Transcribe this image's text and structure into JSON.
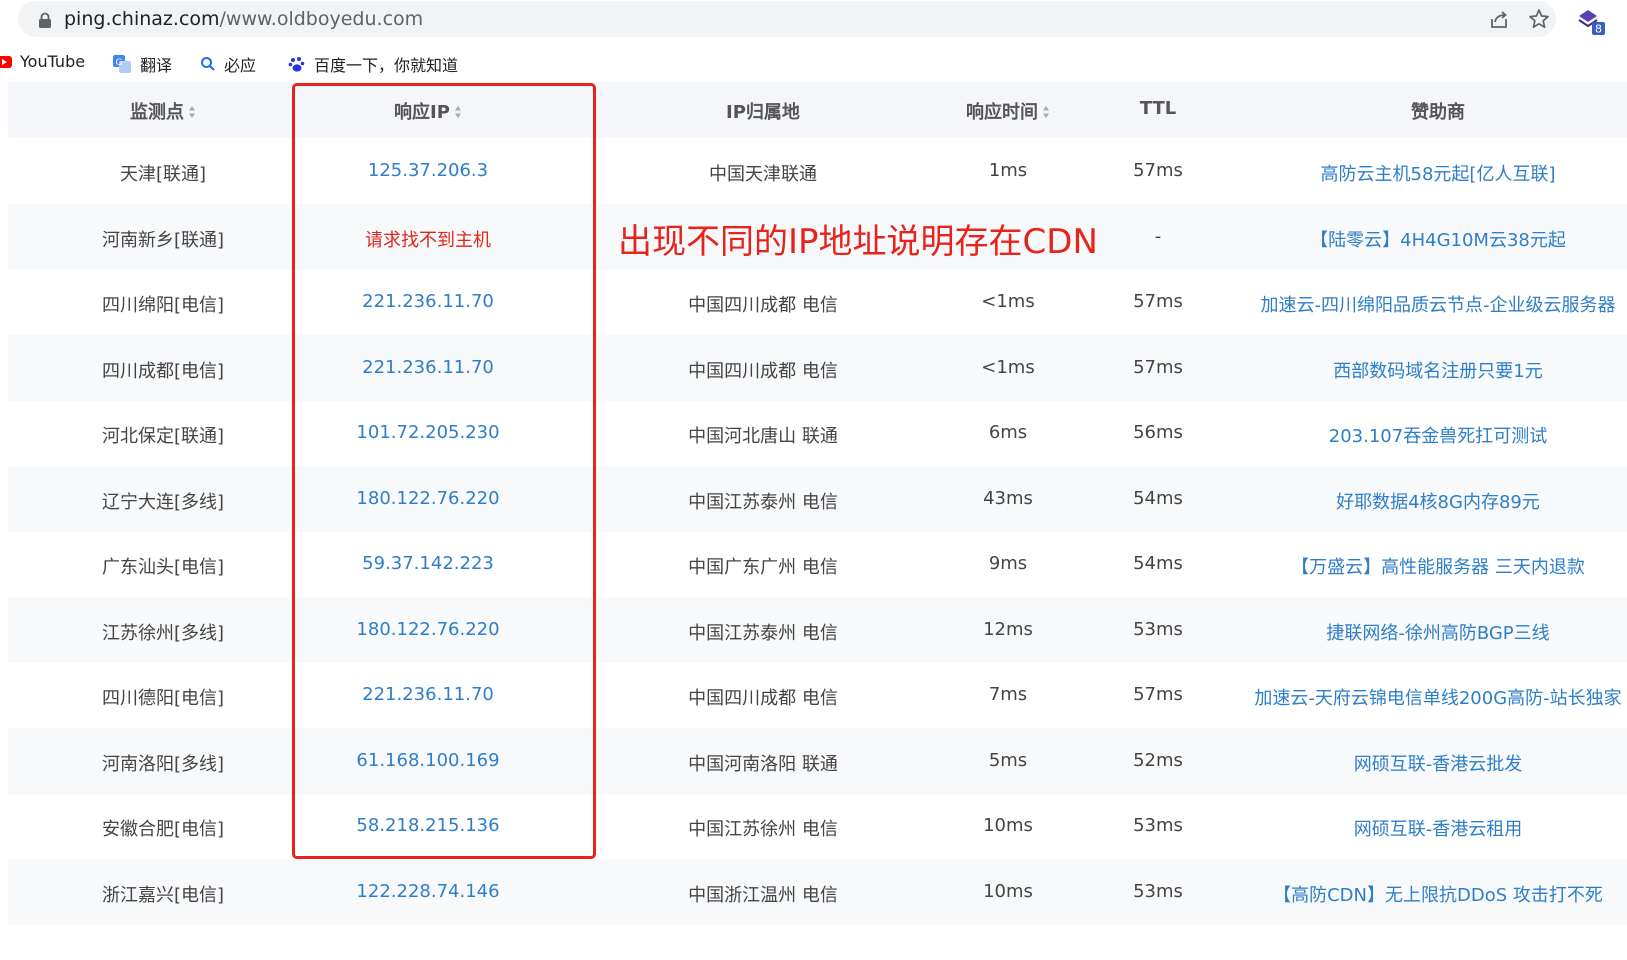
{
  "browser": {
    "url_host": "ping.chinaz.com",
    "url_path": "/www.oldboyedu.com",
    "extension_badge": "8"
  },
  "bookmarks": [
    {
      "label": "YouTube",
      "icon": "youtube-icon"
    },
    {
      "label": "翻译",
      "icon": "translate-icon"
    },
    {
      "label": "必应",
      "icon": "search-icon"
    },
    {
      "label": "百度一下，你就知道",
      "icon": "baidu-paw-icon"
    }
  ],
  "table": {
    "headers": [
      "监测点",
      "响应IP",
      "IP归属地",
      "响应时间",
      "TTL",
      "赞助商"
    ],
    "rows": [
      {
        "location": "天津[联通]",
        "ip": "125.37.206.3",
        "region": "中国天津联通",
        "time": "1ms",
        "ttl": "57ms",
        "sponsor": "高防云主机58元起[亿人互联]"
      },
      {
        "location": "河南新乡[联通]",
        "ip": "请求找不到主机",
        "region": "",
        "time": "",
        "ttl": "-",
        "sponsor": "【陆零云】4H4G10M云38元起",
        "error": true
      },
      {
        "location": "四川绵阳[电信]",
        "ip": "221.236.11.70",
        "region": "中国四川成都 电信",
        "time": "<1ms",
        "ttl": "57ms",
        "sponsor": "加速云-四川绵阳品质云节点-企业级云服务器"
      },
      {
        "location": "四川成都[电信]",
        "ip": "221.236.11.70",
        "region": "中国四川成都 电信",
        "time": "<1ms",
        "ttl": "57ms",
        "sponsor": "西部数码域名注册只要1元"
      },
      {
        "location": "河北保定[联通]",
        "ip": "101.72.205.230",
        "region": "中国河北唐山 联通",
        "time": "6ms",
        "ttl": "56ms",
        "sponsor": "203.107吞金兽死扛可测试"
      },
      {
        "location": "辽宁大连[多线]",
        "ip": "180.122.76.220",
        "region": "中国江苏泰州 电信",
        "time": "43ms",
        "ttl": "54ms",
        "sponsor": "好耶数据4核8G内存89元"
      },
      {
        "location": "广东汕头[电信]",
        "ip": "59.37.142.223",
        "region": "中国广东广州 电信",
        "time": "9ms",
        "ttl": "54ms",
        "sponsor": "【万盛云】高性能服务器 三天内退款"
      },
      {
        "location": "江苏徐州[多线]",
        "ip": "180.122.76.220",
        "region": "中国江苏泰州 电信",
        "time": "12ms",
        "ttl": "53ms",
        "sponsor": "捷联网络-徐州高防BGP三线"
      },
      {
        "location": "四川德阳[电信]",
        "ip": "221.236.11.70",
        "region": "中国四川成都 电信",
        "time": "7ms",
        "ttl": "57ms",
        "sponsor": "加速云-天府云锦电信单线200G高防-站长独家"
      },
      {
        "location": "河南洛阳[多线]",
        "ip": "61.168.100.169",
        "region": "中国河南洛阳 联通",
        "time": "5ms",
        "ttl": "52ms",
        "sponsor": "网硕互联-香港云批发"
      },
      {
        "location": "安徽合肥[电信]",
        "ip": "58.218.215.136",
        "region": "中国江苏徐州 电信",
        "time": "10ms",
        "ttl": "53ms",
        "sponsor": "网硕互联-香港云租用"
      },
      {
        "location": "浙江嘉兴[电信]",
        "ip": "122.228.74.146",
        "region": "中国浙江温州 电信",
        "time": "10ms",
        "ttl": "53ms",
        "sponsor": "【高防CDN】无上限抗DDoS 攻击打不死"
      }
    ]
  },
  "annotation": {
    "text": "出现不同的IP地址说明存在CDN",
    "color": "#e8231b"
  },
  "colors": {
    "link": "#2e7ec8",
    "error": "#e0251c",
    "header_bg": "#f4f6f9"
  }
}
